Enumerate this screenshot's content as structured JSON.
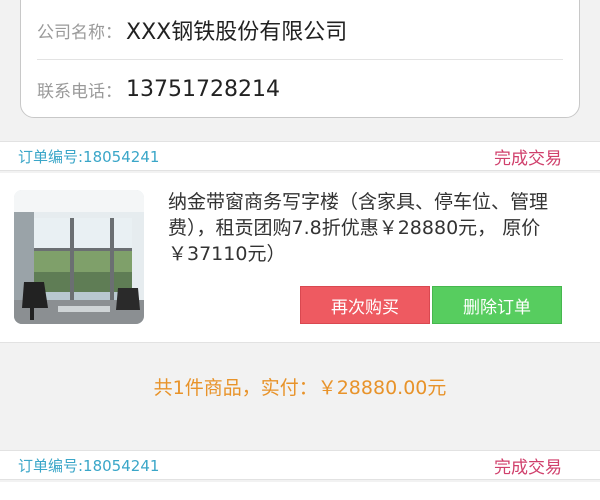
{
  "company_card": {
    "company_label": "公司名称：",
    "company_value": "XXX钢铁股份有限公司",
    "phone_label": "联系电话：",
    "phone_value": "13751728214"
  },
  "orders": [
    {
      "order_no": "订单编号:18054241",
      "status": "完成交易",
      "product": {
        "image_icon": "office-photo",
        "description": "纳金带窗商务写字楼（含家具、停车位、管理费），租贡团购7.8折优惠￥28880元， 原价￥37110元）"
      },
      "buttons": {
        "rebuy": "再次购买",
        "delete": "删除订单"
      },
      "summary": "共1件商品，实付：￥28880.00元"
    },
    {
      "order_no": "订单编号:18054241",
      "status": "完成交易"
    }
  ],
  "colors": {
    "order_no": "#3aa6c8",
    "status": "#d0406c",
    "rebuy_button": "#ee5a61",
    "delete_button": "#57cd5f",
    "summary": "#e8932a"
  }
}
